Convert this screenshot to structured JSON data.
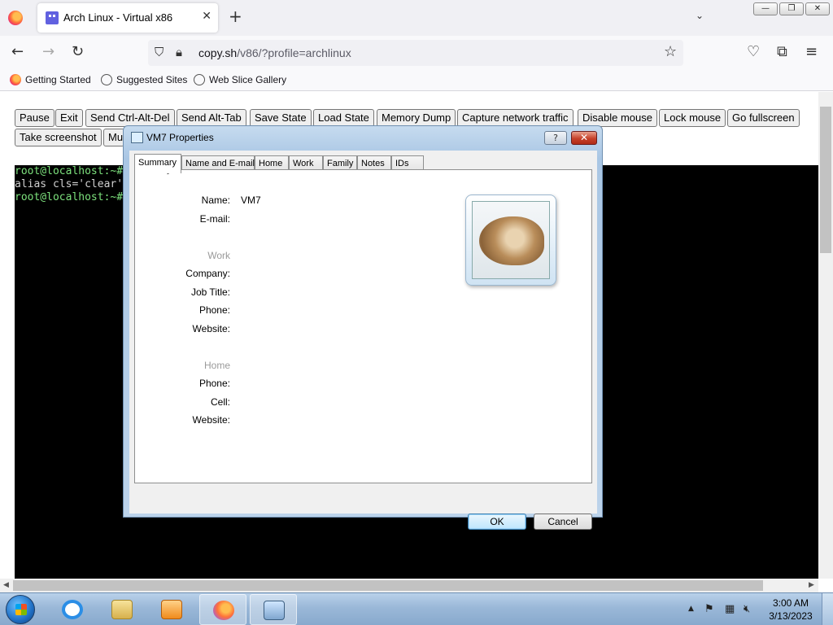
{
  "browser": {
    "tab_title": "Arch Linux - Virtual x86",
    "url_host": "copy.sh",
    "url_path": "/v86/?profile=archlinux",
    "bookmarks": [
      {
        "label": "Getting Started",
        "icon": "firefox-icon"
      },
      {
        "label": "Suggested Sites",
        "icon": "globe-icon"
      },
      {
        "label": "Web Slice Gallery",
        "icon": "globe-icon"
      }
    ]
  },
  "toolbar": {
    "row1": [
      "Pause",
      "Exit",
      "Send Ctrl-Alt-Del",
      "Send Alt-Tab",
      "Save State",
      "Load State",
      "Memory Dump",
      "Capture network traffic",
      "Disable mouse",
      "Lock mouse",
      "Go fullscreen"
    ],
    "row2": [
      "Take screenshot",
      "Mu"
    ]
  },
  "terminal": {
    "line1": "root@localhost:~#",
    "line2": "alias cls='clear'",
    "line3": "root@localhost:~#"
  },
  "dialog": {
    "title": "VM7 Properties",
    "help": "?",
    "close": "✕",
    "tabs": [
      "Summary",
      "Name and E-mail",
      "Home",
      "Work",
      "Family",
      "Notes",
      "IDs"
    ],
    "fields": {
      "name_label": "Name:",
      "name_value": "VM7",
      "email_label": "E-mail:",
      "work_section": "Work",
      "company_label": "Company:",
      "job_title_label": "Job Title:",
      "work_phone_label": "Phone:",
      "work_website_label": "Website:",
      "home_section": "Home",
      "home_phone_label": "Phone:",
      "cell_label": "Cell:",
      "home_website_label": "Website:"
    },
    "ok": "OK",
    "cancel": "Cancel"
  },
  "taskbar": {
    "time": "3:00 AM",
    "date": "3/13/2023"
  }
}
